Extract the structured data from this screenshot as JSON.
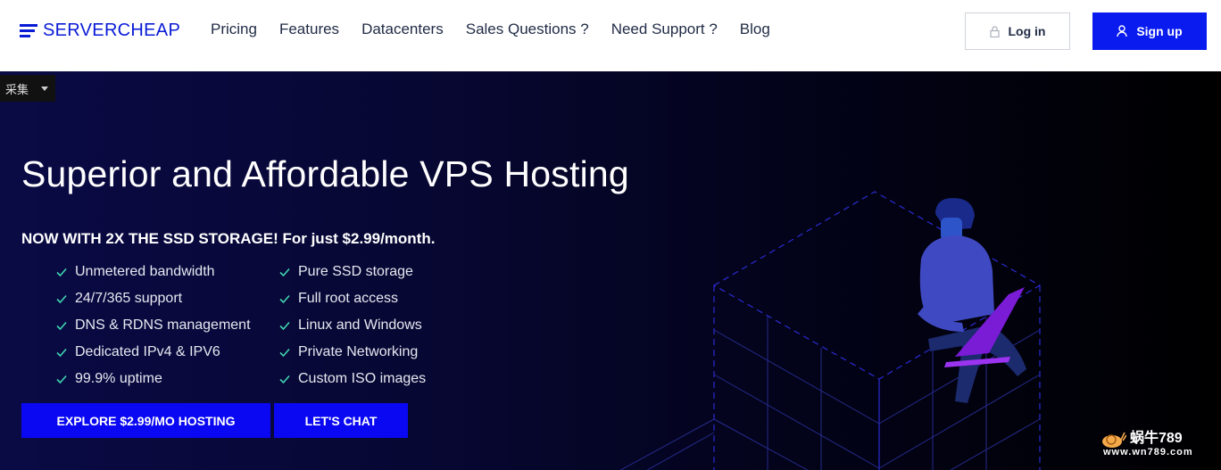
{
  "brand": {
    "name": "SERVERCHEAP",
    "accent": "#0a1bf0"
  },
  "nav": {
    "items": [
      {
        "label": "Pricing"
      },
      {
        "label": "Features"
      },
      {
        "label": "Datacenters"
      },
      {
        "label": "Sales Questions ?"
      },
      {
        "label": "Need Support ?"
      },
      {
        "label": "Blog"
      }
    ]
  },
  "auth": {
    "login_label": "Log in",
    "login_icon": "lock-icon",
    "signup_label": "Sign up",
    "signup_icon": "user-icon"
  },
  "widget": {
    "collect_label": "采集"
  },
  "hero": {
    "title": "Superior and Affordable VPS Hosting",
    "subtitle": "NOW WITH 2X THE SSD STORAGE! For just $2.99/month.",
    "features": [
      "Unmetered bandwidth",
      "Pure SSD storage",
      "24/7/365 support",
      "Full root access",
      "DNS & RDNS management",
      "Linux and Windows",
      "Dedicated IPv4 & IPV6",
      "Private Networking",
      "99.9% uptime",
      "Custom ISO images"
    ],
    "check_color": "#3fd6b0",
    "explore_label": "EXPLORE $2.99/MO HOSTING",
    "chat_label": "LET'S CHAT"
  },
  "watermark": {
    "title": "蜗牛789",
    "url": "www.wn789.com"
  }
}
